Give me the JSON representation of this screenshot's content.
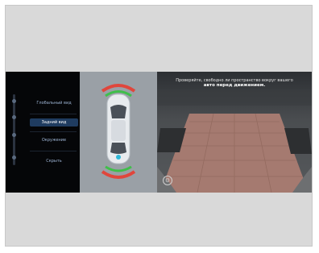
{
  "menu": {
    "items": [
      {
        "label": "Глобальный вид"
      },
      {
        "label": "Задний вид",
        "active": true
      },
      {
        "label": "Окружение"
      },
      {
        "label": "Скрыть"
      }
    ]
  },
  "camera": {
    "warning": "Проверяйте, свободно ли пространство вокруг вашего",
    "warning_emphasis": "авто перед движением."
  },
  "colors": {
    "sensor_red": "#e0463c",
    "sensor_green": "#3fbf4a",
    "menu_active": "#1f3c60",
    "car_accent": "#2fb8d8"
  },
  "icons": [
    "scroll-dot",
    "camera-settings-icon",
    "car-top-icon"
  ]
}
